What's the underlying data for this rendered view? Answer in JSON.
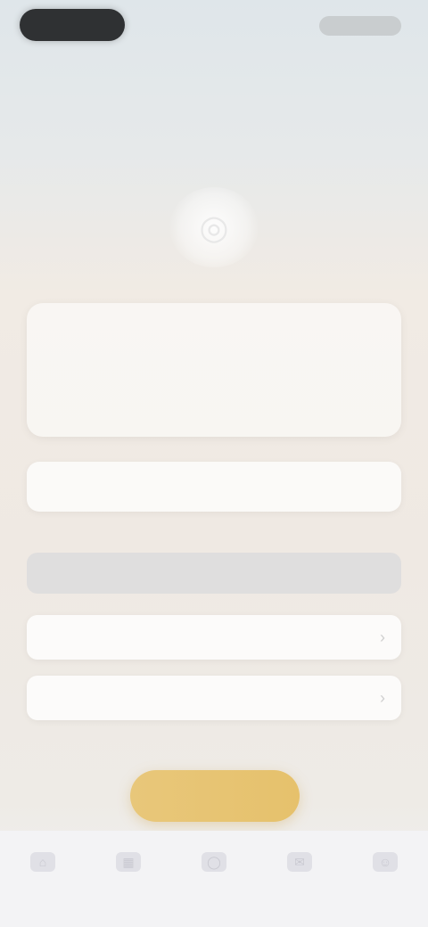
{
  "status_bar": {
    "time": "",
    "indicators": ""
  },
  "header": {
    "title": ""
  },
  "hero": {
    "emblem_icon": "image-icon"
  },
  "summary_card": {
    "rows": [
      {
        "label": "",
        "value": ""
      },
      {
        "label": "",
        "value": ""
      }
    ]
  },
  "form": {
    "field_1": {
      "placeholder": ""
    },
    "section_label": "",
    "select_1": {
      "value": ""
    },
    "select_2": {
      "value": ""
    },
    "note": ""
  },
  "primary_button": {
    "label": ""
  },
  "tabbar": {
    "items": [
      {
        "label": "",
        "icon": "home-icon"
      },
      {
        "label": "",
        "icon": "grid-icon"
      },
      {
        "label": "",
        "icon": "center-icon"
      },
      {
        "label": "",
        "icon": "chat-icon"
      },
      {
        "label": "",
        "icon": "profile-icon"
      }
    ]
  },
  "colors": {
    "accent": "#e6c16c",
    "background_top": "#dfe6ea",
    "background_mid": "#f1ebe4",
    "tabbar": "#f3f3f5"
  }
}
